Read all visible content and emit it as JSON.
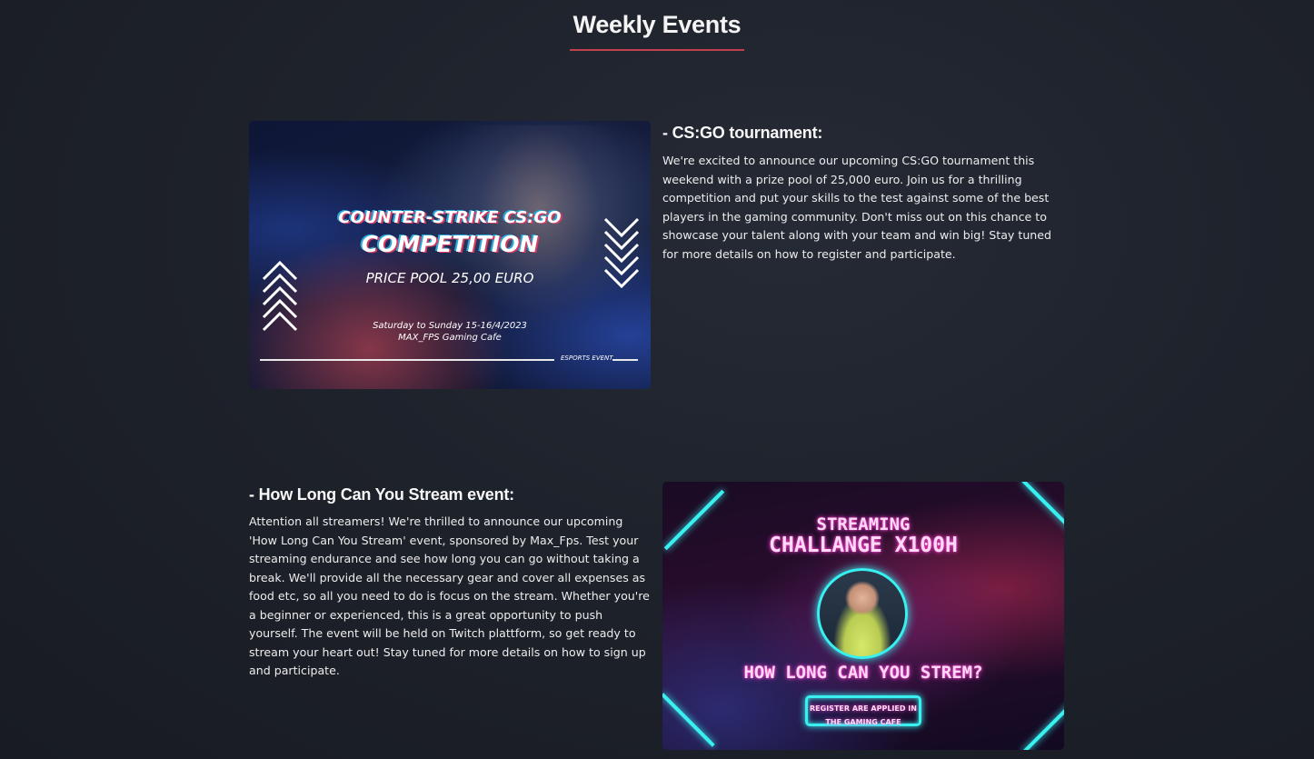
{
  "page": {
    "heading": "Weekly Events",
    "accent_color": "#c0404e"
  },
  "events": [
    {
      "title": "- CS:GO tournament:",
      "description": "We're excited to announce our upcoming CS:GO tournament this weekend with a prize pool of 25,000 euro. Join us for a thrilling competition and put your skills to the test against some of the best players in the gaming community. Don't miss out on this chance to showcase your talent along with your team and win big! Stay tuned for more details on how to register and participate.",
      "poster": {
        "line1": "COUNTER-STRIKE CS:GO",
        "line2": "COMPETITION",
        "line3": "PRICE POOL 25,00 EURO",
        "line4": "Saturday to Sunday 15-16/4/2023",
        "line5": "MAX_FPS Gaming Cafe",
        "tag": "ESPORTS EVENT"
      }
    },
    {
      "title": "- How Long Can You Stream event:",
      "description": "Attention all streamers! We're thrilled to announce our upcoming 'How Long Can You Stream' event, sponsored by Max_Fps. Test your streaming endurance and see how long you can go without taking a break. We'll provide all the necessary gear and cover all expenses as food etc, so all you need to do is focus on the stream. Whether you're a beginner or experienced, this is a great opportunity to push yourself. The event will be held on Twitch plattform, so get ready to stream your heart out! Stay tuned for more details on how to sign up and participate.",
      "poster": {
        "line1": "STREAMING",
        "line2": "CHALLANGE X100H",
        "line3": "HOW LONG CAN YOU STREM?",
        "line4": "REGISTER ARE APPLIED IN",
        "line5": "THE GAMING CAFE"
      }
    }
  ]
}
